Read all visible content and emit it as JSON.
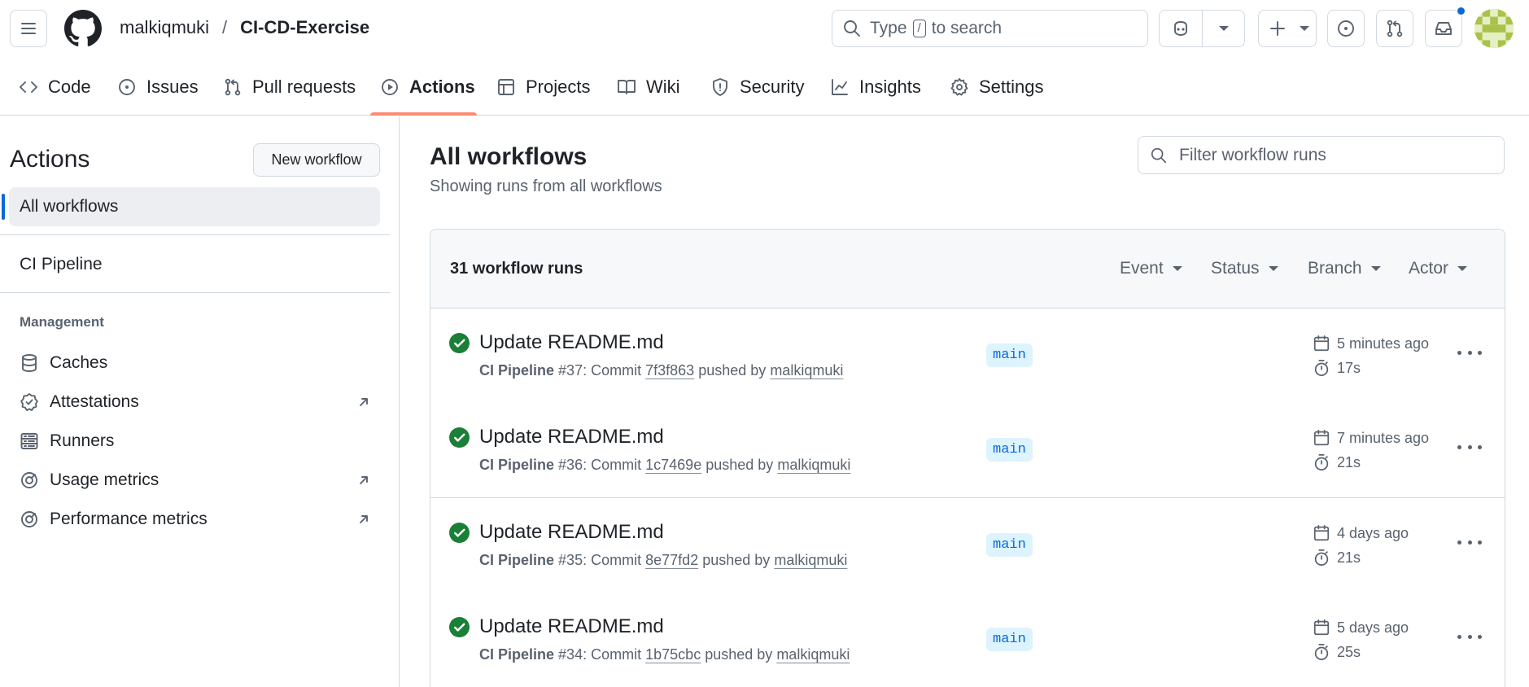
{
  "header": {
    "owner": "malkiqmuki",
    "separator": "/",
    "repo": "CI-CD-Exercise",
    "search_prefix": "Type",
    "search_key": "/",
    "search_suffix": "to search",
    "notification_dot_color": "#0969da"
  },
  "tabs": [
    {
      "label": "Code",
      "icon": "code-icon"
    },
    {
      "label": "Issues",
      "icon": "issue-opened-icon"
    },
    {
      "label": "Pull requests",
      "icon": "git-pull-request-icon"
    },
    {
      "label": "Actions",
      "icon": "play-icon",
      "selected": true
    },
    {
      "label": "Projects",
      "icon": "table-icon"
    },
    {
      "label": "Wiki",
      "icon": "book-icon"
    },
    {
      "label": "Security",
      "icon": "shield-icon"
    },
    {
      "label": "Insights",
      "icon": "graph-icon"
    },
    {
      "label": "Settings",
      "icon": "gear-icon"
    }
  ],
  "sidebar": {
    "title": "Actions",
    "new_workflow": "New workflow",
    "all_workflows": "All workflows",
    "workflows": [
      "CI Pipeline"
    ],
    "management_label": "Management",
    "management": [
      {
        "label": "Caches",
        "icon": "database-icon",
        "external": false
      },
      {
        "label": "Attestations",
        "icon": "verified-icon",
        "external": true
      },
      {
        "label": "Runners",
        "icon": "server-icon",
        "external": false
      },
      {
        "label": "Usage metrics",
        "icon": "meter-icon",
        "external": true
      },
      {
        "label": "Performance metrics",
        "icon": "meter-icon",
        "external": true
      }
    ]
  },
  "main": {
    "title": "All workflows",
    "subtitle": "Showing runs from all workflows",
    "filter_placeholder": "Filter workflow runs",
    "runs_count": "31 workflow runs",
    "filters": [
      "Event",
      "Status",
      "Branch",
      "Actor"
    ],
    "runs": [
      {
        "title": "Update README.md",
        "workflow": "CI Pipeline",
        "number": "#37",
        "commit": "7f3f863",
        "actor": "malkiqmuki",
        "branch": "main",
        "time": "5 minutes ago",
        "duration": "17s",
        "status": "success"
      },
      {
        "title": "Update README.md",
        "workflow": "CI Pipeline",
        "number": "#36",
        "commit": "1c7469e",
        "actor": "malkiqmuki",
        "branch": "main",
        "time": "7 minutes ago",
        "duration": "21s",
        "status": "success"
      },
      {
        "title": "Update README.md",
        "workflow": "CI Pipeline",
        "number": "#35",
        "commit": "8e77fd2",
        "actor": "malkiqmuki",
        "branch": "main",
        "time": "4 days ago",
        "duration": "21s",
        "status": "success"
      },
      {
        "title": "Update README.md",
        "workflow": "CI Pipeline",
        "number": "#34",
        "commit": "1b75cbc",
        "actor": "malkiqmuki",
        "branch": "main",
        "time": "5 days ago",
        "duration": "25s",
        "status": "success"
      }
    ],
    "run_meta_words": {
      "commit": "Commit",
      "pushed_by": "pushed by",
      "colon": ":"
    }
  },
  "colors": {
    "success": "#1a7f37",
    "accent": "#0969da",
    "tab_underline": "#fd8c73"
  }
}
